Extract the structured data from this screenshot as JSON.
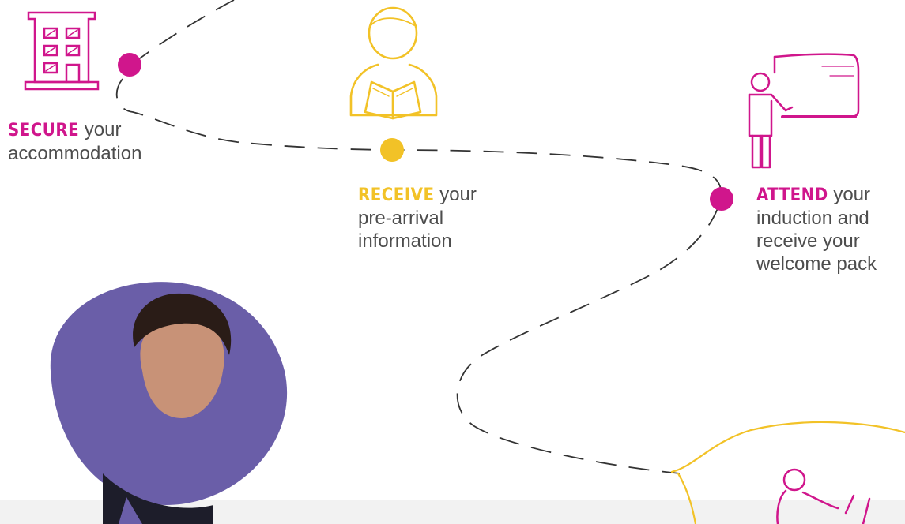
{
  "steps": {
    "secure": {
      "keyword": "SECURE",
      "line1": " your",
      "line2": "accommodation"
    },
    "receive": {
      "keyword": "RECEIVE",
      "line1": " your",
      "line2": "pre-arrival",
      "line3": "information"
    },
    "attend": {
      "keyword": "ATTEND",
      "line1": " your",
      "line2": "induction and",
      "line3": "receive your",
      "line4": "welcome pack"
    }
  },
  "colors": {
    "pink": "#d0168c",
    "yellow": "#f2c227",
    "path_dash": "#333333",
    "photo_bg": "#6a5ea8",
    "band": "#f2f2f2"
  },
  "icons": {
    "building": "building-icon",
    "reader": "person-reading-icon",
    "teacher": "presenter-board-icon",
    "laptop": "person-laptop-icon"
  }
}
